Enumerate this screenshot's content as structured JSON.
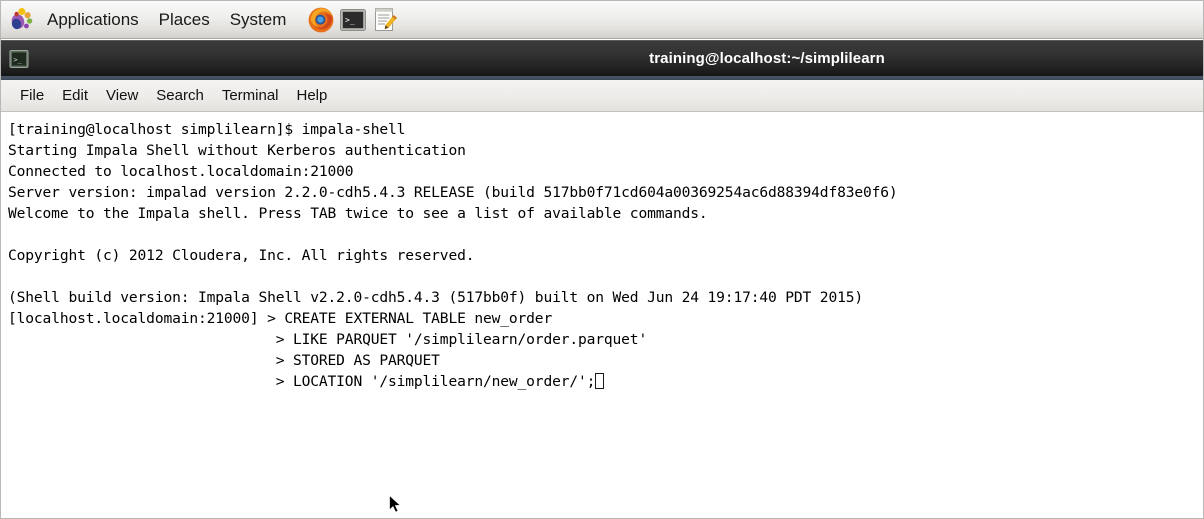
{
  "panel": {
    "logo_icon": "gnome-foot-icon",
    "menus": [
      {
        "label": "Applications",
        "name": "panel-menu-applications"
      },
      {
        "label": "Places",
        "name": "panel-menu-places"
      },
      {
        "label": "System",
        "name": "panel-menu-system"
      }
    ],
    "launchers": [
      {
        "icon": "firefox-icon",
        "name": "launcher-firefox"
      },
      {
        "icon": "terminal-icon",
        "name": "launcher-terminal"
      },
      {
        "icon": "text-editor-icon",
        "name": "launcher-text-editor"
      }
    ]
  },
  "window": {
    "icon": "terminal-window-icon",
    "title": "training@localhost:~/simplilearn",
    "menubar": [
      {
        "label": "File",
        "name": "menu-file"
      },
      {
        "label": "Edit",
        "name": "menu-edit"
      },
      {
        "label": "View",
        "name": "menu-view"
      },
      {
        "label": "Search",
        "name": "menu-search"
      },
      {
        "label": "Terminal",
        "name": "menu-terminal"
      },
      {
        "label": "Help",
        "name": "menu-help"
      }
    ]
  },
  "terminal": {
    "lines": [
      "[training@localhost simplilearn]$ impala-shell",
      "Starting Impala Shell without Kerberos authentication",
      "Connected to localhost.localdomain:21000",
      "Server version: impalad version 2.2.0-cdh5.4.3 RELEASE (build 517bb0f71cd604a00369254ac6d88394df83e0f6)",
      "Welcome to the Impala shell. Press TAB twice to see a list of available commands.",
      "",
      "Copyright (c) 2012 Cloudera, Inc. All rights reserved.",
      "",
      "(Shell build version: Impala Shell v2.2.0-cdh5.4.3 (517bb0f) built on Wed Jun 24 19:17:40 PDT 2015)",
      "[localhost.localdomain:21000] > CREATE EXTERNAL TABLE new_order",
      "                               > LIKE PARQUET '/simplilearn/order.parquet'",
      "                               > STORED AS PARQUET",
      "                               > LOCATION '/simplilearn/new_order/';"
    ],
    "cursor_after_last_line": true
  },
  "colors": {
    "titlebar_dark": "#242424",
    "titlebar_accent": "#43505f",
    "panel_background": "#eeeeec",
    "terminal_background": "#ffffff",
    "terminal_text": "#000000"
  }
}
